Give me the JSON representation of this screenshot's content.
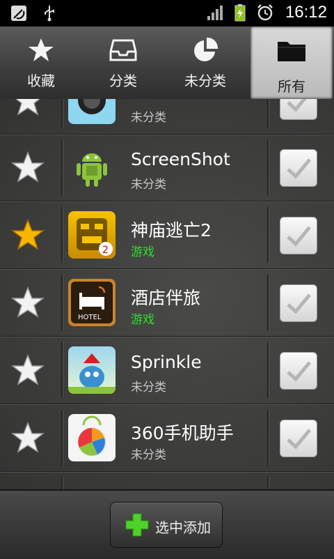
{
  "status_bar": {
    "time": "16:12",
    "icons": [
      "notification-icon",
      "usb-icon",
      "signal-icon",
      "battery-charging-icon",
      "alarm-icon"
    ]
  },
  "tabs": [
    {
      "label": "收藏",
      "icon": "star-icon",
      "active": false
    },
    {
      "label": "分类",
      "icon": "inbox-icon",
      "active": false
    },
    {
      "label": "未分类",
      "icon": "pie-chart-icon",
      "active": false
    },
    {
      "label": "所有",
      "icon": "folder-icon",
      "active": true
    }
  ],
  "apps": [
    {
      "name": "",
      "category": "未分类",
      "starred": false,
      "checked": true,
      "icon": "camera-app-icon"
    },
    {
      "name": "ScreenShot",
      "category": "未分类",
      "starred": false,
      "checked": true,
      "icon": "android-robot-icon"
    },
    {
      "name": "神庙逃亡2",
      "category": "游戏",
      "starred": true,
      "checked": true,
      "icon": "temple-run-icon"
    },
    {
      "name": "酒店伴旅",
      "category": "游戏",
      "starred": false,
      "checked": true,
      "icon": "hotel-icon"
    },
    {
      "name": "Sprinkle",
      "category": "未分类",
      "starred": false,
      "checked": true,
      "icon": "sprinkle-icon"
    },
    {
      "name": "360手机助手",
      "category": "未分类",
      "starred": false,
      "checked": true,
      "icon": "360-assistant-icon"
    }
  ],
  "bottom": {
    "add_label": "选中添加"
  },
  "colors": {
    "game_category": "#2ee02e",
    "star_active": "#f7b500"
  }
}
